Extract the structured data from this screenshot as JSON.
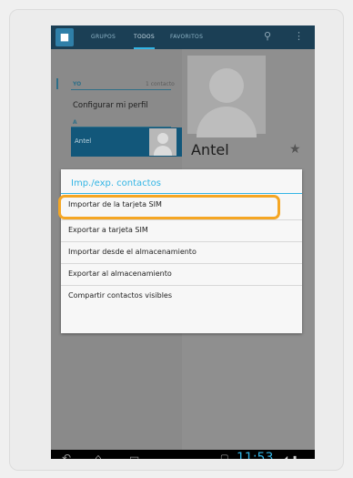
{
  "actionbar": {
    "tabs": [
      {
        "label": "GRUPOS"
      },
      {
        "label": "TODOS"
      },
      {
        "label": "FAVORITOS"
      }
    ],
    "search_icon": "search-icon",
    "overflow_icon": "overflow-menu-icon"
  },
  "list": {
    "me_header": "YO",
    "me_count": "1 contacto",
    "config_profile": "Configurar mi perfil",
    "section_letter": "A",
    "contact_name": "Antel"
  },
  "detail": {
    "name": "Antel",
    "star_icon": "star-icon"
  },
  "dialog": {
    "title": "Imp./exp. contactos",
    "items": [
      "Importar de la tarjeta SIM",
      "Exportar a tarjeta SIM",
      "Importar desde el almacenamiento",
      "Exportar al almacenamiento",
      "Compartir contactos visibles"
    ]
  },
  "navbar": {
    "clock": "11:53"
  },
  "colors": {
    "accent": "#33b5e5",
    "highlight": "#f5a623"
  }
}
